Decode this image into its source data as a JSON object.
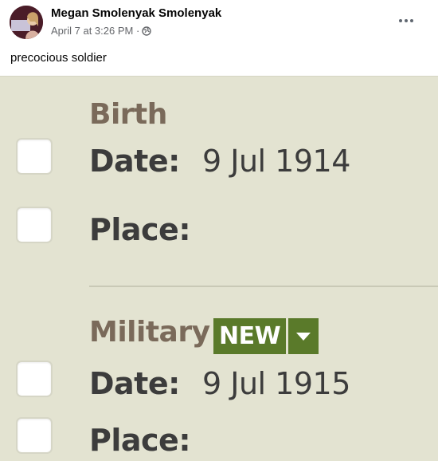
{
  "post": {
    "author": "Megan Smolenyak Smolenyak",
    "timestamp": "April 7 at 3:26 PM",
    "separator": "·",
    "caption": "precocious soldier"
  },
  "record": {
    "birth": {
      "heading": "Birth",
      "date_label": "Date:",
      "date_value": "9 Jul 1914",
      "place_label": "Place:"
    },
    "military": {
      "heading": "Military",
      "badge": "NEW",
      "date_label": "Date:",
      "date_value": "9 Jul 1915",
      "place_label": "Place:"
    }
  },
  "colors": {
    "panel_bg": "#e3e3d1",
    "heading": "#7a6a5a",
    "badge": "#5a7a2a",
    "text": "#3c3c3c"
  },
  "icons": [
    "globe-icon",
    "more-options-icon",
    "dropdown-arrow-icon"
  ]
}
